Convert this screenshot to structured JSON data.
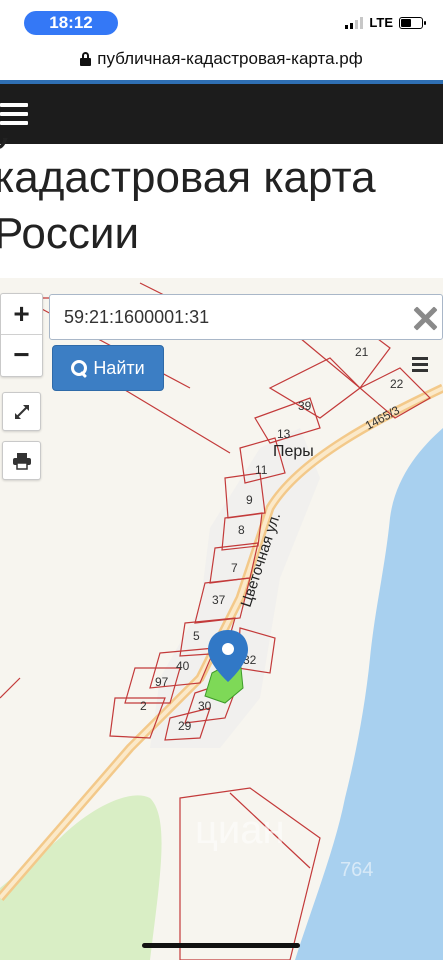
{
  "status_bar": {
    "time": "18:12",
    "network": "LTE"
  },
  "browser": {
    "url": "публичная-кадастровая-карта.рф"
  },
  "page": {
    "headline_line1": "кадастровая карта",
    "headline_line2": "России",
    "headline_clipped": "у"
  },
  "map": {
    "search": {
      "value": "59:21:1600001:31",
      "button_label": "Найти"
    },
    "zoom": {
      "in_label": "+",
      "out_label": "−"
    },
    "labels": {
      "village": "Перы",
      "street": "Цветочная ул.",
      "road_cadastral": "1465/3",
      "watermark": "циан",
      "watermark_number": "764"
    },
    "parcel_numbers": [
      "21",
      "22",
      "39",
      "13",
      "11",
      "9",
      "8",
      "7",
      "37",
      "5",
      "32",
      "40",
      "97",
      "2",
      "30",
      "29"
    ],
    "colors": {
      "river": "#a8d0ef",
      "forest": "#d9eec5",
      "parcel_outline": "#c33a3a",
      "selected_parcel": "#7ed957",
      "marker": "#3178c6"
    }
  }
}
